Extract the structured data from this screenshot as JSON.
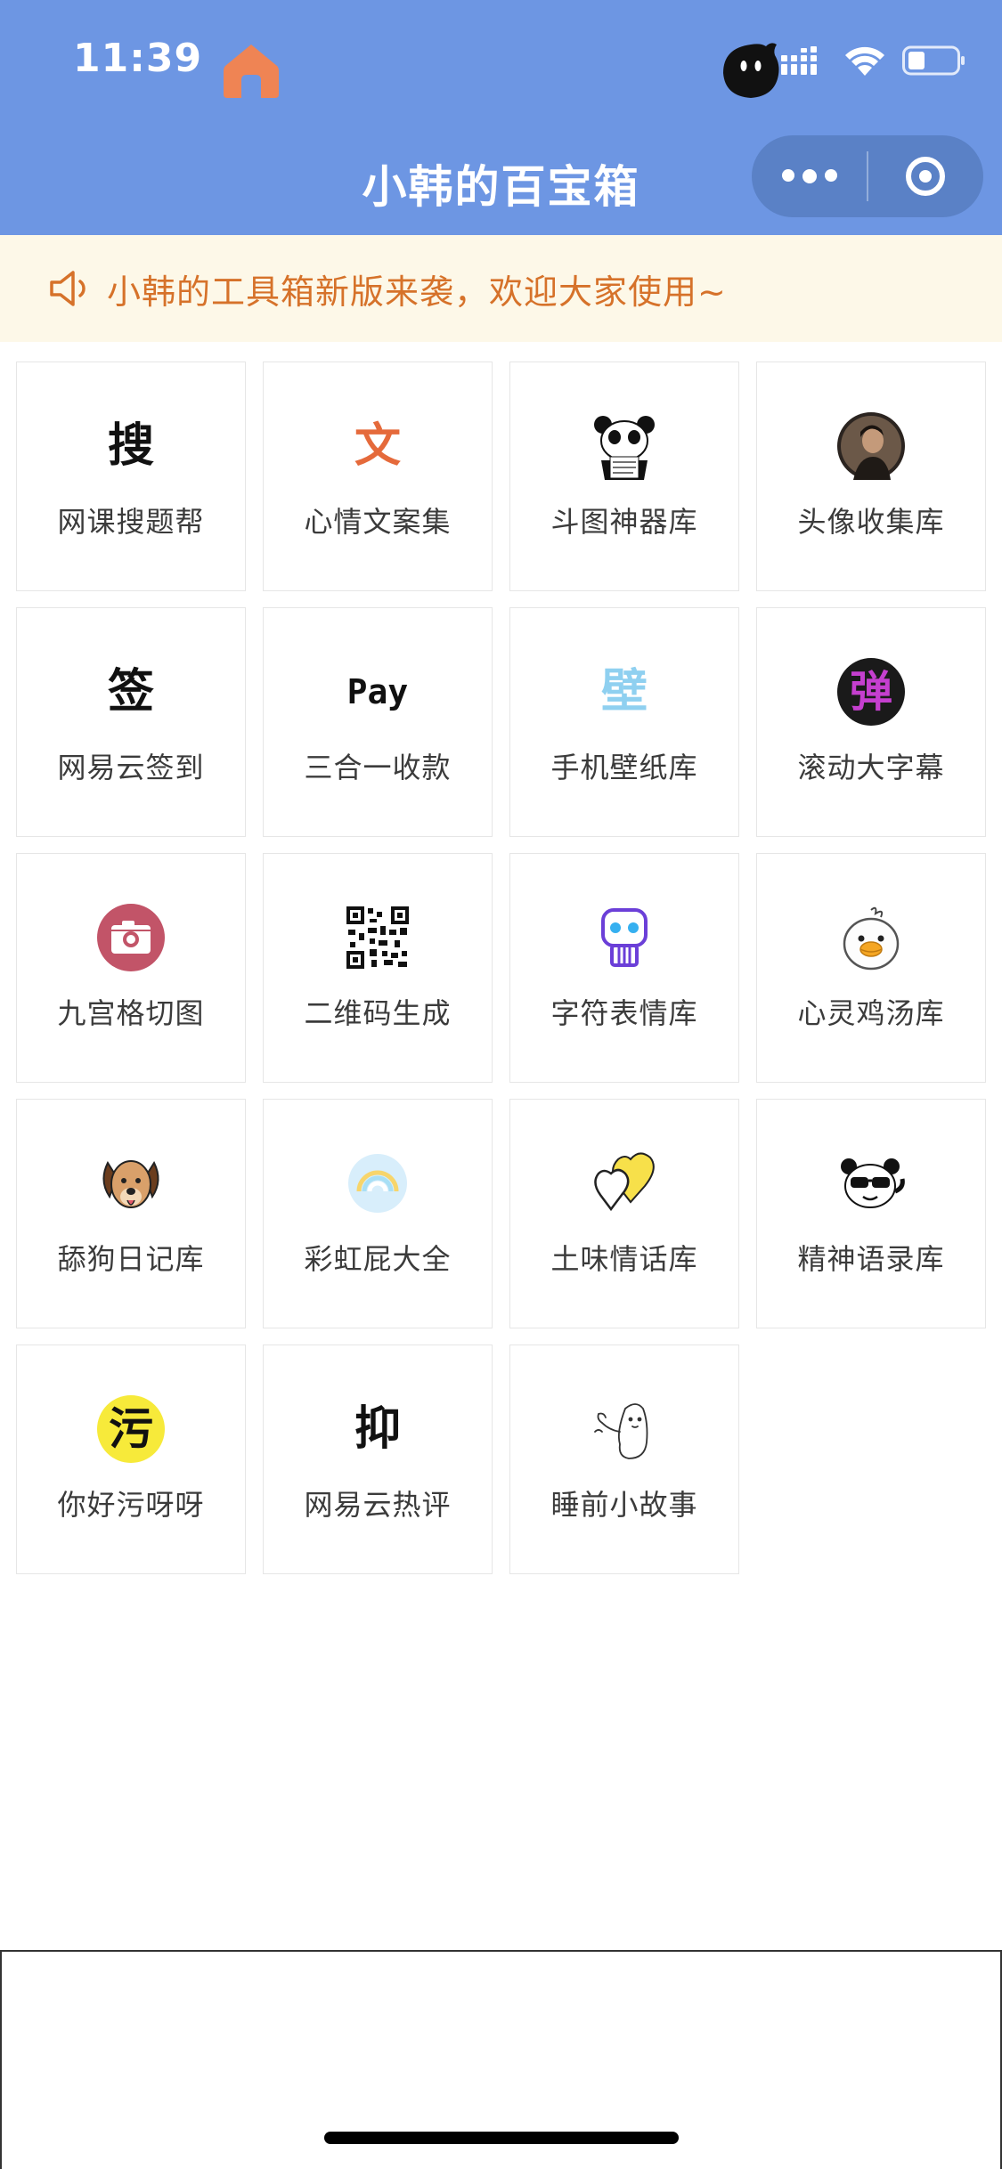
{
  "status_bar": {
    "time": "11:39"
  },
  "header": {
    "title": "小韩的百宝箱"
  },
  "notice": {
    "text": "小韩的工具箱新版来袭，欢迎大家使用~"
  },
  "tools": [
    {
      "label": "网课搜题帮",
      "icon": "search-glyph-icon",
      "glyph": "搜"
    },
    {
      "label": "心情文案集",
      "icon": "text-glyph-icon",
      "glyph": "文"
    },
    {
      "label": "斗图神器库",
      "icon": "panda-meme-icon"
    },
    {
      "label": "头像收集库",
      "icon": "avatar-photo-icon"
    },
    {
      "label": "网易云签到",
      "icon": "checkin-glyph-icon",
      "glyph": "签"
    },
    {
      "label": "三合一收款",
      "icon": "pay-icon",
      "glyph": "Pay"
    },
    {
      "label": "手机壁纸库",
      "icon": "wallpaper-glyph-icon",
      "glyph": "壁"
    },
    {
      "label": "滚动大字幕",
      "icon": "led-marquee-icon",
      "glyph": "弹"
    },
    {
      "label": "九宫格切图",
      "icon": "camera-icon"
    },
    {
      "label": "二维码生成",
      "icon": "qr-code-icon"
    },
    {
      "label": "字符表情库",
      "icon": "skull-icon"
    },
    {
      "label": "心灵鸡汤库",
      "icon": "duck-icon"
    },
    {
      "label": "舔狗日记库",
      "icon": "dog-icon"
    },
    {
      "label": "彩虹屁大全",
      "icon": "rainbow-icon"
    },
    {
      "label": "土味情话库",
      "icon": "hearts-icon"
    },
    {
      "label": "精神语录库",
      "icon": "panda-sunglasses-icon"
    },
    {
      "label": "你好污呀呀",
      "icon": "dirty-glyph-icon",
      "glyph": "污"
    },
    {
      "label": "网易云热评",
      "icon": "comment-glyph-icon",
      "glyph": "抑"
    },
    {
      "label": "睡前小故事",
      "icon": "sketch-figure-icon"
    }
  ],
  "colors": {
    "header_bg": "#6d96e3",
    "notice_bg": "#fdf8e8",
    "notice_text": "#d6722a",
    "home_tab": "#ef8454"
  }
}
